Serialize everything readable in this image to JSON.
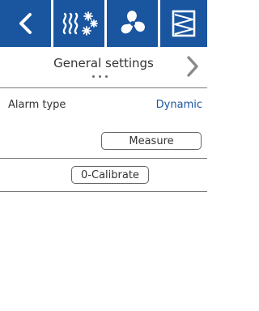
{
  "header": {
    "tabs": [
      {
        "name": "back",
        "icon": "chevron-left-icon"
      },
      {
        "name": "heating-cooling",
        "icon": "heat-snow-icon"
      },
      {
        "name": "ventilation",
        "icon": "fan-icon"
      },
      {
        "name": "filter",
        "icon": "filter-icon"
      }
    ],
    "accent_color": "#1a55a0"
  },
  "page": {
    "title": "General settings",
    "page_dots": 3
  },
  "settings": {
    "alarm_type_label": "Alarm type",
    "alarm_type_value": "Dynamic",
    "measure_button": "Measure",
    "calibrate_button": "0-Calibrate"
  }
}
